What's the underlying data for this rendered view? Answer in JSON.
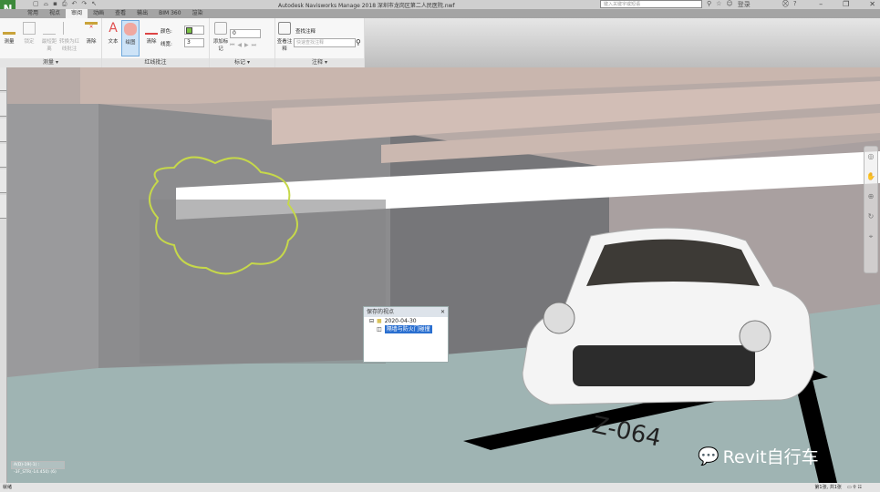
{
  "app": {
    "logo": "N",
    "title": "Autodesk Navisworks Manage 2018    深圳市龙岗区第二人民医院.nwf",
    "search_placeholder": "键入关键字或短语",
    "login": "登录"
  },
  "tabs": [
    "常用",
    "视点",
    "审阅",
    "动画",
    "查看",
    "输出",
    "BIM 360",
    "渲染"
  ],
  "active_tab": "审阅",
  "ribbon": {
    "measure": {
      "label": "测量 ▾",
      "buttons": [
        "测量",
        "锁定",
        "最短距离",
        "转换为红线批注",
        "清除"
      ]
    },
    "redline": {
      "label": "红线批注",
      "text": "文本",
      "draw": "绘图",
      "erase": "清除",
      "color_label": "颜色:",
      "color": "#7ac143",
      "width_label": "线宽:",
      "width_value": "3"
    },
    "tags": {
      "label": "标记 ▾",
      "add": "添加标记",
      "tag_id": "0"
    },
    "comments": {
      "label": "注释 ▾",
      "view": "查看注释",
      "find": "查找注释",
      "quick_find_placeholder": "快速查找注释"
    }
  },
  "saved_viewpoints": {
    "title": "保存的视点",
    "folder": "2020-04-30",
    "item": "隔墙与防火门碰撞"
  },
  "coord_readout": "A(D)-19(-1) : -3F_STR(-14.450) (6)",
  "status": {
    "left": "就绪",
    "page": "第1张, 共1张"
  },
  "watermark": "Revit自行车",
  "scene_text": {
    "parking_number": "Z-064"
  },
  "colors": {
    "floor": "#9fb4b3",
    "wall": "#8c8c8e",
    "beam": "#c9b6ae",
    "cloud": "#c6d84a"
  }
}
